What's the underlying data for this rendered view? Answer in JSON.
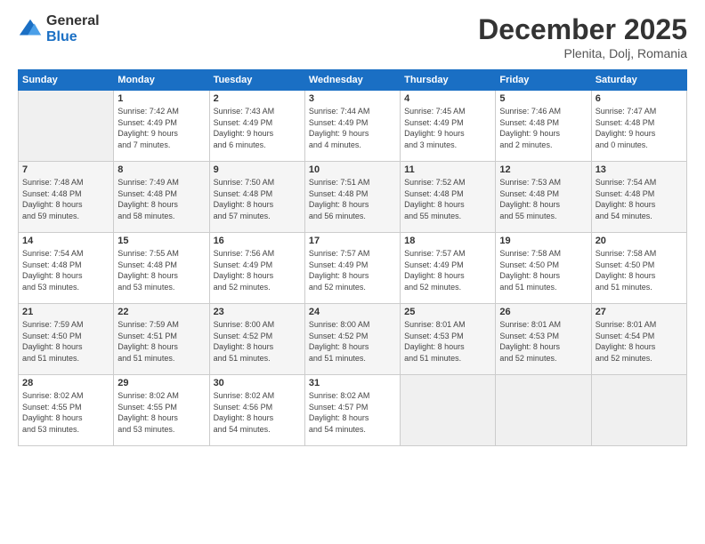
{
  "header": {
    "logo_general": "General",
    "logo_blue": "Blue",
    "title": "December 2025",
    "subtitle": "Plenita, Dolj, Romania"
  },
  "calendar": {
    "days_of_week": [
      "Sunday",
      "Monday",
      "Tuesday",
      "Wednesday",
      "Thursday",
      "Friday",
      "Saturday"
    ],
    "weeks": [
      [
        {
          "day": "",
          "info": ""
        },
        {
          "day": "1",
          "info": "Sunrise: 7:42 AM\nSunset: 4:49 PM\nDaylight: 9 hours\nand 7 minutes."
        },
        {
          "day": "2",
          "info": "Sunrise: 7:43 AM\nSunset: 4:49 PM\nDaylight: 9 hours\nand 6 minutes."
        },
        {
          "day": "3",
          "info": "Sunrise: 7:44 AM\nSunset: 4:49 PM\nDaylight: 9 hours\nand 4 minutes."
        },
        {
          "day": "4",
          "info": "Sunrise: 7:45 AM\nSunset: 4:49 PM\nDaylight: 9 hours\nand 3 minutes."
        },
        {
          "day": "5",
          "info": "Sunrise: 7:46 AM\nSunset: 4:48 PM\nDaylight: 9 hours\nand 2 minutes."
        },
        {
          "day": "6",
          "info": "Sunrise: 7:47 AM\nSunset: 4:48 PM\nDaylight: 9 hours\nand 0 minutes."
        }
      ],
      [
        {
          "day": "7",
          "info": "Sunrise: 7:48 AM\nSunset: 4:48 PM\nDaylight: 8 hours\nand 59 minutes."
        },
        {
          "day": "8",
          "info": "Sunrise: 7:49 AM\nSunset: 4:48 PM\nDaylight: 8 hours\nand 58 minutes."
        },
        {
          "day": "9",
          "info": "Sunrise: 7:50 AM\nSunset: 4:48 PM\nDaylight: 8 hours\nand 57 minutes."
        },
        {
          "day": "10",
          "info": "Sunrise: 7:51 AM\nSunset: 4:48 PM\nDaylight: 8 hours\nand 56 minutes."
        },
        {
          "day": "11",
          "info": "Sunrise: 7:52 AM\nSunset: 4:48 PM\nDaylight: 8 hours\nand 55 minutes."
        },
        {
          "day": "12",
          "info": "Sunrise: 7:53 AM\nSunset: 4:48 PM\nDaylight: 8 hours\nand 55 minutes."
        },
        {
          "day": "13",
          "info": "Sunrise: 7:54 AM\nSunset: 4:48 PM\nDaylight: 8 hours\nand 54 minutes."
        }
      ],
      [
        {
          "day": "14",
          "info": "Sunrise: 7:54 AM\nSunset: 4:48 PM\nDaylight: 8 hours\nand 53 minutes."
        },
        {
          "day": "15",
          "info": "Sunrise: 7:55 AM\nSunset: 4:48 PM\nDaylight: 8 hours\nand 53 minutes."
        },
        {
          "day": "16",
          "info": "Sunrise: 7:56 AM\nSunset: 4:49 PM\nDaylight: 8 hours\nand 52 minutes."
        },
        {
          "day": "17",
          "info": "Sunrise: 7:57 AM\nSunset: 4:49 PM\nDaylight: 8 hours\nand 52 minutes."
        },
        {
          "day": "18",
          "info": "Sunrise: 7:57 AM\nSunset: 4:49 PM\nDaylight: 8 hours\nand 52 minutes."
        },
        {
          "day": "19",
          "info": "Sunrise: 7:58 AM\nSunset: 4:50 PM\nDaylight: 8 hours\nand 51 minutes."
        },
        {
          "day": "20",
          "info": "Sunrise: 7:58 AM\nSunset: 4:50 PM\nDaylight: 8 hours\nand 51 minutes."
        }
      ],
      [
        {
          "day": "21",
          "info": "Sunrise: 7:59 AM\nSunset: 4:50 PM\nDaylight: 8 hours\nand 51 minutes."
        },
        {
          "day": "22",
          "info": "Sunrise: 7:59 AM\nSunset: 4:51 PM\nDaylight: 8 hours\nand 51 minutes."
        },
        {
          "day": "23",
          "info": "Sunrise: 8:00 AM\nSunset: 4:52 PM\nDaylight: 8 hours\nand 51 minutes."
        },
        {
          "day": "24",
          "info": "Sunrise: 8:00 AM\nSunset: 4:52 PM\nDaylight: 8 hours\nand 51 minutes."
        },
        {
          "day": "25",
          "info": "Sunrise: 8:01 AM\nSunset: 4:53 PM\nDaylight: 8 hours\nand 51 minutes."
        },
        {
          "day": "26",
          "info": "Sunrise: 8:01 AM\nSunset: 4:53 PM\nDaylight: 8 hours\nand 52 minutes."
        },
        {
          "day": "27",
          "info": "Sunrise: 8:01 AM\nSunset: 4:54 PM\nDaylight: 8 hours\nand 52 minutes."
        }
      ],
      [
        {
          "day": "28",
          "info": "Sunrise: 8:02 AM\nSunset: 4:55 PM\nDaylight: 8 hours\nand 53 minutes."
        },
        {
          "day": "29",
          "info": "Sunrise: 8:02 AM\nSunset: 4:55 PM\nDaylight: 8 hours\nand 53 minutes."
        },
        {
          "day": "30",
          "info": "Sunrise: 8:02 AM\nSunset: 4:56 PM\nDaylight: 8 hours\nand 54 minutes."
        },
        {
          "day": "31",
          "info": "Sunrise: 8:02 AM\nSunset: 4:57 PM\nDaylight: 8 hours\nand 54 minutes."
        },
        {
          "day": "",
          "info": ""
        },
        {
          "day": "",
          "info": ""
        },
        {
          "day": "",
          "info": ""
        }
      ]
    ]
  }
}
